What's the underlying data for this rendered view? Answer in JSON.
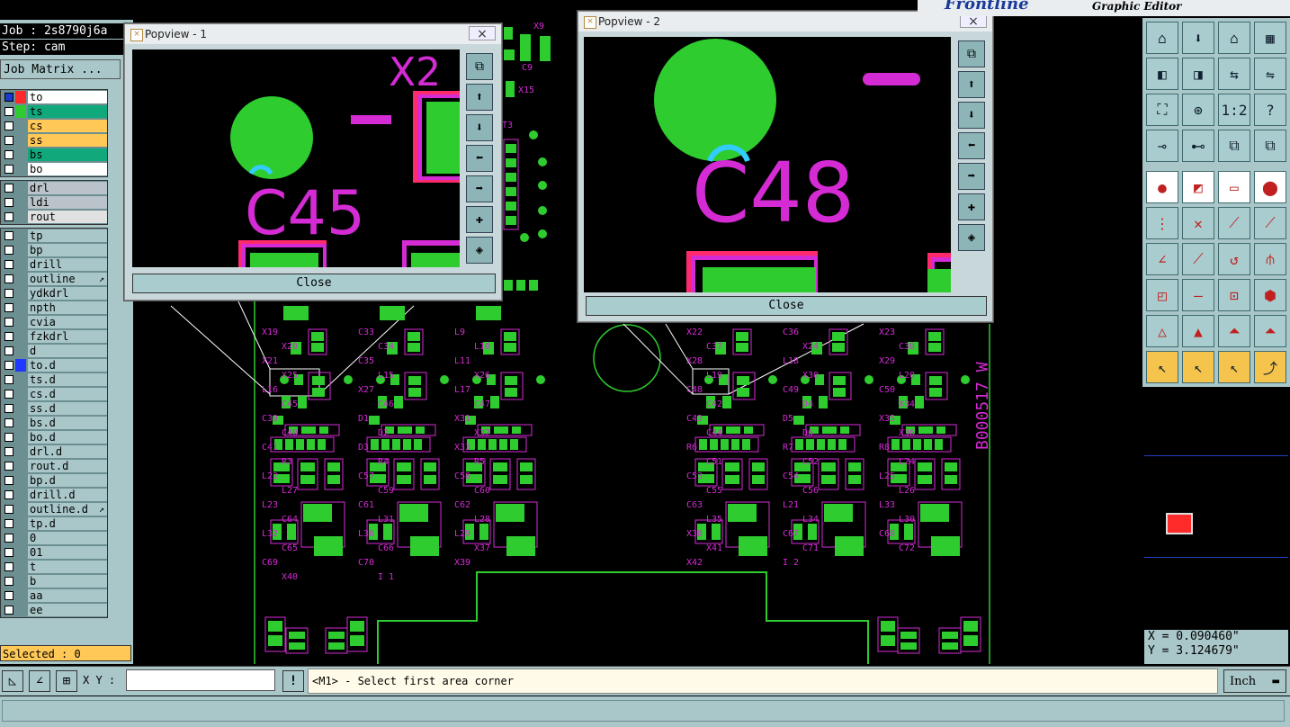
{
  "app": {
    "brand": "Frontline",
    "subtitle": "Graphic Editor"
  },
  "job": {
    "job_label": "Job : 2s8790j6a",
    "step_label": "Step: cam",
    "matrix_button": "Job Matrix ..."
  },
  "layers_board": [
    {
      "label": "to",
      "color": "#ff2a2a",
      "active": true,
      "bg": "#ffffff"
    },
    {
      "label": "ts",
      "color": "#2ecc2e",
      "bg": "#11a87c"
    },
    {
      "label": "cs",
      "color": "",
      "bg": "#ffc857"
    },
    {
      "label": "ss",
      "color": "",
      "bg": "#ffc857"
    },
    {
      "label": "bs",
      "color": "",
      "bg": "#11a87c"
    },
    {
      "label": "bo",
      "color": "",
      "bg": "#ffffff"
    }
  ],
  "layers_drill": [
    {
      "label": "drl",
      "bg": "#b9c3c9"
    },
    {
      "label": "ldi",
      "bg": "#b9c3c9"
    },
    {
      "label": "rout",
      "bg": "#e0e0e0"
    }
  ],
  "layers_misc": [
    {
      "label": "tp"
    },
    {
      "label": "bp"
    },
    {
      "label": "drill"
    },
    {
      "label": "outline",
      "icon": true
    },
    {
      "label": "ydkdrl"
    },
    {
      "label": "npth"
    },
    {
      "label": "cvia"
    },
    {
      "label": "fzkdrl"
    },
    {
      "label": "d"
    },
    {
      "label": "to.d",
      "color": "#2038ff"
    },
    {
      "label": "ts.d"
    },
    {
      "label": "cs.d"
    },
    {
      "label": "ss.d"
    },
    {
      "label": "bs.d"
    },
    {
      "label": "bo.d"
    },
    {
      "label": "drl.d"
    },
    {
      "label": "rout.d"
    },
    {
      "label": "bp.d"
    },
    {
      "label": "drill.d"
    },
    {
      "label": "outline.d",
      "icon": true
    },
    {
      "label": "tp.d"
    },
    {
      "label": "0"
    },
    {
      "label": "01"
    },
    {
      "label": "t"
    },
    {
      "label": "b"
    },
    {
      "label": "aa"
    },
    {
      "label": "ee"
    }
  ],
  "selected": "Selected : 0",
  "popview1": {
    "title": "Popview - 1",
    "close": "Close",
    "close_x": "×",
    "label": "C45"
  },
  "popview2": {
    "title": "Popview - 2",
    "close": "Close",
    "close_x": "×",
    "label": "C48"
  },
  "coords": {
    "x": "X = 0.090460\"",
    "y": "Y = 3.124679\""
  },
  "command": {
    "xy_label": "X Y :",
    "xy_value": "",
    "prompt": "<M1> - Select first area corner",
    "units": "Inch"
  },
  "board_text": {
    "refs_left": [
      "X19",
      "C33",
      "L9",
      "X20",
      "C34",
      "L10",
      "X21",
      "C35",
      "L11",
      "X25",
      "L15",
      "X26",
      "L16",
      "X27",
      "L17",
      "C45",
      "C46",
      "C47",
      "C39",
      "D1",
      "X31",
      "C40",
      "D2",
      "X32",
      "C41",
      "D3",
      "X33",
      "R3",
      "R4",
      "R5",
      "L22",
      "C57",
      "C58",
      "L27",
      "C59",
      "C60",
      "L23",
      "C61",
      "C62",
      "C64",
      "L31",
      "L28",
      "L32",
      "L36",
      "L29",
      "C65",
      "C66",
      "X37",
      "C69",
      "C70",
      "X39",
      "X40",
      "I 1"
    ],
    "refs_right": [
      "X22",
      "C36",
      "X23",
      "C37",
      "X24",
      "C38",
      "X28",
      "L18",
      "X29",
      "L19",
      "X30",
      "L20",
      "C48",
      "C49",
      "C50",
      "C42",
      "D4",
      "X34",
      "C43",
      "D5",
      "X35",
      "C44",
      "D6",
      "X36",
      "R6",
      "R7",
      "R8",
      "C51",
      "C52",
      "L24",
      "C53",
      "C54",
      "L25",
      "C55",
      "C56",
      "L26",
      "C63",
      "L21",
      "L33",
      "L35",
      "L34",
      "L30",
      "X38",
      "C67",
      "C68",
      "X41",
      "C71",
      "C72",
      "X42",
      "I 2"
    ],
    "vertical": "B000517 W",
    "top_refs": [
      "X9",
      "C9",
      "X15",
      "T3"
    ]
  }
}
